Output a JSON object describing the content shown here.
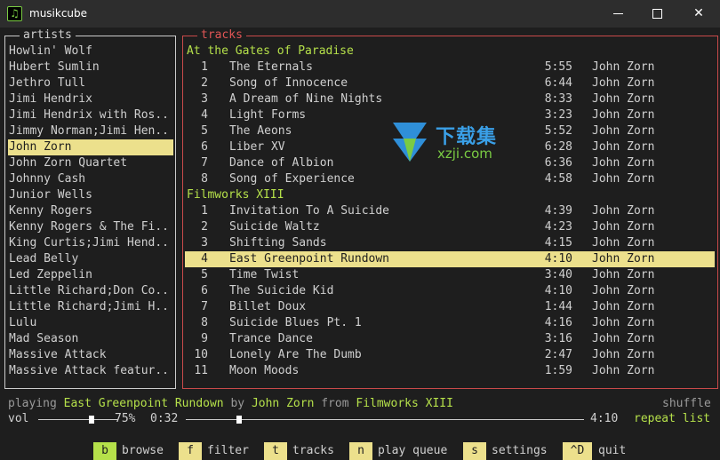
{
  "window": {
    "title": "musikcube",
    "app_icon": "music-note-icon"
  },
  "artists_panel": {
    "title": "artists",
    "selected_index": 8,
    "items": [
      "Howlin' Wolf",
      "Hubert Sumlin",
      "Jethro Tull",
      "Jimi Hendrix",
      "Jimi Hendrix with Ros..",
      "Jimmy Norman;Jimi Hen..",
      "John Zorn",
      "John Zorn Quartet",
      "Johnny Cash",
      "Junior Wells",
      "Kenny Rogers",
      "Kenny Rogers & The Fi..",
      "King Curtis;Jimi Hend..",
      "Lead Belly",
      "Led Zeppelin",
      "Little Richard;Don Co..",
      "Little Richard;Jimi H..",
      "Lulu",
      "Mad Season",
      "Massive Attack",
      "Massive Attack featur.."
    ]
  },
  "tracks_panel": {
    "title": "tracks",
    "albums": [
      {
        "name": "At the Gates of Paradise",
        "tracks": [
          {
            "num": "1",
            "title": "The Eternals",
            "duration": "5:55",
            "artist": "John Zorn"
          },
          {
            "num": "2",
            "title": "Song of Innocence",
            "duration": "6:44",
            "artist": "John Zorn"
          },
          {
            "num": "3",
            "title": "A Dream of Nine Nights",
            "duration": "8:33",
            "artist": "John Zorn"
          },
          {
            "num": "4",
            "title": "Light Forms",
            "duration": "3:23",
            "artist": "John Zorn"
          },
          {
            "num": "5",
            "title": "The Aeons",
            "duration": "5:52",
            "artist": "John Zorn"
          },
          {
            "num": "6",
            "title": "Liber XV",
            "duration": "6:28",
            "artist": "John Zorn"
          },
          {
            "num": "7",
            "title": "Dance of Albion",
            "duration": "6:36",
            "artist": "John Zorn"
          },
          {
            "num": "8",
            "title": "Song of Experience",
            "duration": "4:58",
            "artist": "John Zorn"
          }
        ]
      },
      {
        "name": "Filmworks XIII",
        "tracks": [
          {
            "num": "1",
            "title": "Invitation To A Suicide",
            "duration": "4:39",
            "artist": "John Zorn"
          },
          {
            "num": "2",
            "title": "Suicide Waltz",
            "duration": "4:23",
            "artist": "John Zorn"
          },
          {
            "num": "3",
            "title": "Shifting Sands",
            "duration": "4:15",
            "artist": "John Zorn"
          },
          {
            "num": "4",
            "title": "East Greenpoint Rundown",
            "duration": "4:10",
            "artist": "John Zorn",
            "selected": true
          },
          {
            "num": "5",
            "title": "Time Twist",
            "duration": "3:40",
            "artist": "John Zorn"
          },
          {
            "num": "6",
            "title": "The Suicide Kid",
            "duration": "4:10",
            "artist": "John Zorn"
          },
          {
            "num": "7",
            "title": "Billet Doux",
            "duration": "1:44",
            "artist": "John Zorn"
          },
          {
            "num": "8",
            "title": "Suicide Blues Pt. 1",
            "duration": "4:16",
            "artist": "John Zorn"
          },
          {
            "num": "9",
            "title": "Trance Dance",
            "duration": "3:16",
            "artist": "John Zorn"
          },
          {
            "num": "10",
            "title": "Lonely Are The Dumb",
            "duration": "2:47",
            "artist": "John Zorn"
          },
          {
            "num": "11",
            "title": "Moon Moods",
            "duration": "1:59",
            "artist": "John Zorn"
          }
        ]
      }
    ]
  },
  "status": {
    "playing_label": "playing",
    "track": "East Greenpoint Rundown",
    "by_label": "by",
    "artist": "John Zorn",
    "from_label": "from",
    "album": "Filmworks XIII",
    "shuffle_label": "shuffle"
  },
  "transport": {
    "vol_label": "vol",
    "volume_percent": "75%",
    "volume_level": 0.75,
    "elapsed": "0:32",
    "total": "4:10",
    "seek_fraction": 0.128,
    "repeat_label": "repeat list"
  },
  "shortcuts": [
    {
      "key": "b",
      "label": "browse"
    },
    {
      "key": "f",
      "label": "filter"
    },
    {
      "key": "t",
      "label": "tracks"
    },
    {
      "key": "n",
      "label": "play queue"
    },
    {
      "key": "s",
      "label": "settings"
    },
    {
      "key": "^D",
      "label": "quit"
    }
  ],
  "watermark": {
    "text_cn": "下载集",
    "url": "xzji.com"
  },
  "colors": {
    "background": "#1e1e1e",
    "selection": "#ece08c",
    "accent_green": "#b5e04a",
    "tracks_border": "#c94a4a"
  }
}
